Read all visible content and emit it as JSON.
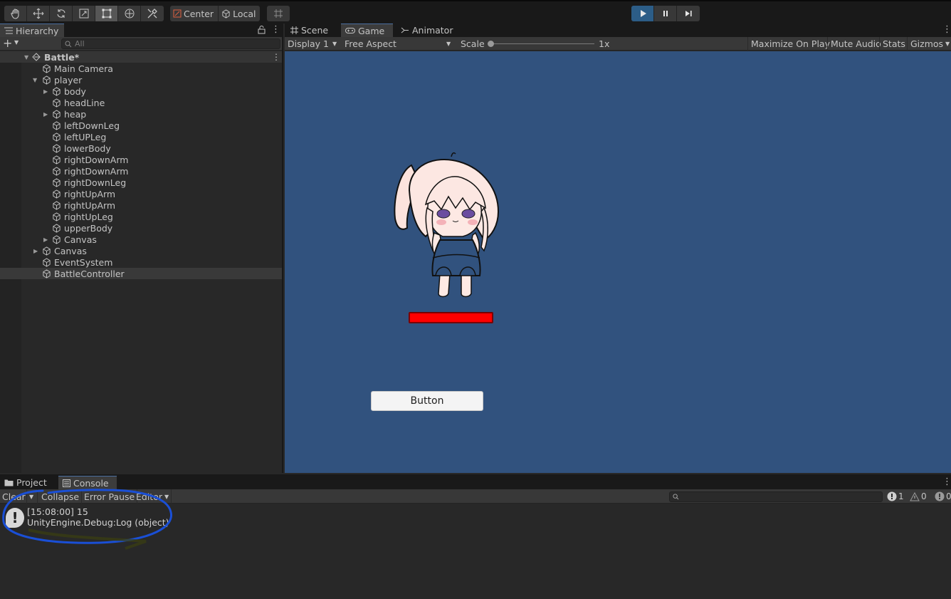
{
  "toolbar": {
    "pivot_label": "Center",
    "space_label": "Local"
  },
  "hierarchy": {
    "tab_label": "Hierarchy",
    "search_placeholder": "All",
    "scene_name": "Battle*",
    "items": [
      {
        "label": "Main Camera"
      },
      {
        "label": "player"
      },
      {
        "label": "body"
      },
      {
        "label": "headLine"
      },
      {
        "label": "heap"
      },
      {
        "label": "leftDownLeg"
      },
      {
        "label": "leftUPLeg"
      },
      {
        "label": "lowerBody"
      },
      {
        "label": "rightDownArm"
      },
      {
        "label": "rightDownArm"
      },
      {
        "label": "rightDownLeg"
      },
      {
        "label": "rightUpArm"
      },
      {
        "label": "rightUpArm"
      },
      {
        "label": "rightUpLeg"
      },
      {
        "label": "upperBody"
      },
      {
        "label": "Canvas"
      },
      {
        "label": "Canvas"
      },
      {
        "label": "EventSystem"
      },
      {
        "label": "BattleController"
      }
    ]
  },
  "view_tabs": {
    "scene": "Scene",
    "game": "Game",
    "animator": "Animator"
  },
  "game_toolbar": {
    "display": "Display 1",
    "aspect": "Free Aspect",
    "scale_label": "Scale",
    "scale_value": "1x",
    "maximize": "Maximize On Play",
    "mute": "Mute Audio",
    "stats": "Stats",
    "gizmos": "Gizmos"
  },
  "game_view": {
    "button_label": "Button",
    "health_fill": 1.0,
    "background_color": "#31527e",
    "health_color": "#ff0000"
  },
  "bottom_tabs": {
    "project": "Project",
    "console": "Console"
  },
  "console_toolbar": {
    "clear": "Clear",
    "collapse": "Collapse",
    "error_pause": "Error Pause",
    "editor": "Editor",
    "log_count": "1",
    "warn_count": "0",
    "error_count": "0"
  },
  "console_log": {
    "line1": "[15:08:00] 15",
    "line2": "UnityEngine.Debug:Log (object)"
  },
  "annotation_color": "#1a4fd6"
}
